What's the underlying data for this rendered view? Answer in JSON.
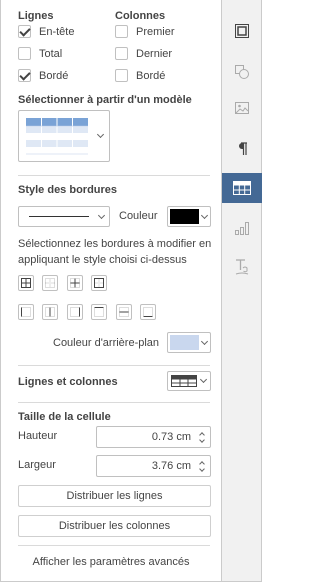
{
  "rows_section": {
    "title": "Lignes",
    "items": [
      {
        "label": "En-tête",
        "checked": true
      },
      {
        "label": "Total",
        "checked": false
      },
      {
        "label": "Bordé",
        "checked": true
      }
    ]
  },
  "columns_section": {
    "title": "Colonnes",
    "items": [
      {
        "label": "Premier",
        "checked": false
      },
      {
        "label": "Dernier",
        "checked": false
      },
      {
        "label": "Bordé",
        "checked": false
      }
    ]
  },
  "template": {
    "title": "Sélectionner à partir d'un modèle"
  },
  "borders": {
    "title": "Style des bordures",
    "color_label": "Couleur",
    "border_color": "#000000",
    "instruction": "Sélectionnez les bordures à modifier en appliquant le style choisi ci-dessus",
    "background_label": "Couleur d'arrière-plan",
    "background_color": "#c9d7ee"
  },
  "rows_columns": {
    "title": "Lignes et colonnes"
  },
  "cell_size": {
    "title": "Taille de la cellule",
    "height_label": "Hauteur",
    "height_value": "0.73 cm",
    "width_label": "Largeur",
    "width_value": "3.76 cm",
    "distribute_rows": "Distribuer les lignes",
    "distribute_columns": "Distribuer les colonnes"
  },
  "advanced_link": "Afficher les paramètres avancés",
  "colors": {
    "accent": "#446995",
    "template_blue": "#7aa3d6"
  },
  "toolbar": [
    {
      "name": "slide-settings-icon",
      "active": false
    },
    {
      "name": "shape-settings-icon",
      "active": false
    },
    {
      "name": "image-settings-icon",
      "active": false
    },
    {
      "name": "paragraph-settings-icon",
      "active": false
    },
    {
      "name": "table-settings-icon",
      "active": true
    },
    {
      "name": "chart-settings-icon",
      "active": false
    },
    {
      "name": "text-art-settings-icon",
      "active": false
    }
  ]
}
